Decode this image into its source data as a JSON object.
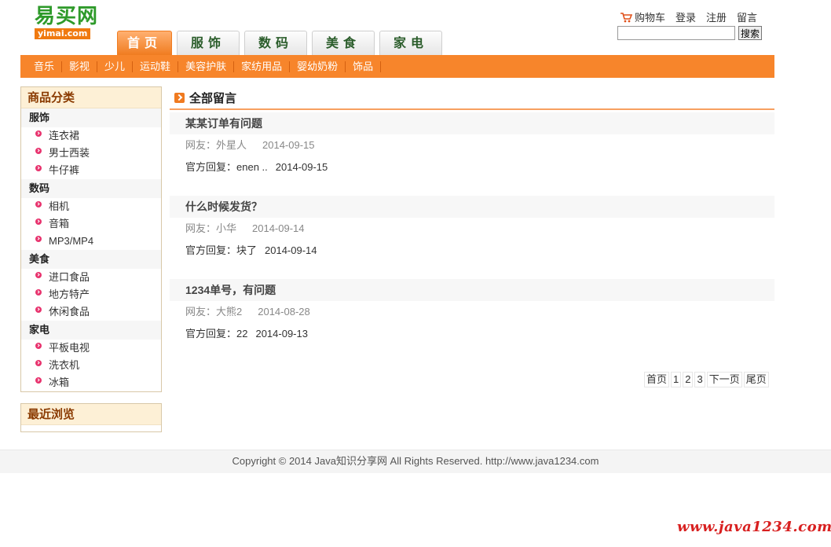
{
  "header": {
    "logo_cn": "易买网",
    "logo_en": "yimai.com",
    "topnav": {
      "cart": "购物车",
      "login": "登录",
      "register": "注册",
      "message": "留言"
    },
    "search": {
      "value": "",
      "button": "搜索"
    }
  },
  "tabs": [
    {
      "label": "首页"
    },
    {
      "label": "服饰"
    },
    {
      "label": "数码"
    },
    {
      "label": "美食"
    },
    {
      "label": "家电"
    }
  ],
  "catbar": [
    "音乐",
    "影视",
    "少儿",
    "运动鞋",
    "美容护肤",
    "家纺用品",
    "婴幼奶粉",
    "饰品"
  ],
  "sidebar": {
    "categories_title": "商品分类",
    "groups": [
      {
        "name": "服饰",
        "items": [
          "连衣裙",
          "男士西装",
          "牛仔裤"
        ]
      },
      {
        "name": "数码",
        "items": [
          "相机",
          "音箱",
          "MP3/MP4"
        ]
      },
      {
        "name": "美食",
        "items": [
          "进口食品",
          "地方特产",
          "休闲食品"
        ]
      },
      {
        "name": "家电",
        "items": [
          "平板电视",
          "洗衣机",
          "冰箱"
        ]
      }
    ],
    "recent_title": "最近浏览"
  },
  "main": {
    "title": "全部留言",
    "messages": [
      {
        "title": "某某订单有问题",
        "user": "网友：外星人",
        "user_date": "2014-09-15",
        "reply": "官方回复：enen ..",
        "reply_date": "2014-09-15"
      },
      {
        "title": "什么时候发货？",
        "user": "网友：小华",
        "user_date": "2014-09-14",
        "reply": "官方回复：块了",
        "reply_date": "2014-09-14"
      },
      {
        "title": "1234单号，有问题",
        "user": "网友：大熊2",
        "user_date": "2014-08-28",
        "reply": "官方回复：22",
        "reply_date": "2014-09-13"
      }
    ]
  },
  "pager": {
    "first": "首页",
    "p1": "1",
    "p2": "2",
    "p3": "3",
    "next": "下一页",
    "last": "尾页"
  },
  "footer": "Copyright © 2014 Java知识分享网 All Rights Reserved. http://www.java1234.com",
  "watermark": "www.java1234.com",
  "colors": {
    "accent": "#f7852b",
    "logo_green": "#2e9a2a",
    "bullet": "#e8336e",
    "watermark": "#d82020"
  }
}
